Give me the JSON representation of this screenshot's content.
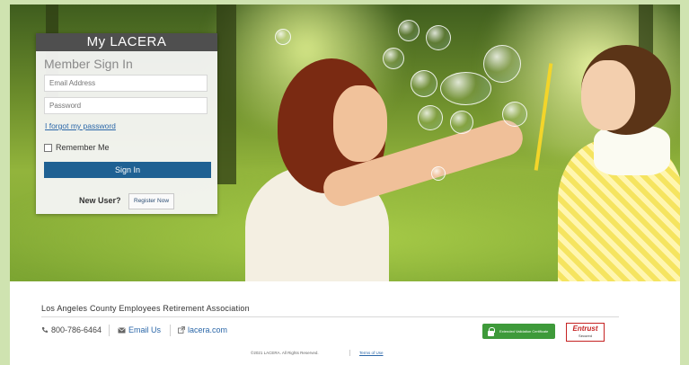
{
  "login": {
    "brand": "My LACERA",
    "title": "Member Sign In",
    "email_placeholder": "Email Address",
    "password_placeholder": "Password",
    "forgot_link": "I forgot my password",
    "remember_label": "Remember Me",
    "signin_label": "Sign In",
    "new_user_label": "New User?",
    "register_label": "Register Now"
  },
  "footer": {
    "org_name": "Los Angeles County Employees Retirement Association",
    "phone": "800-786-6464",
    "email_label": "Email Us",
    "website": "lacera.com",
    "ev_badge": "Extended Validation Certificate",
    "entrust_brand": "Entrust",
    "entrust_sub": "Secured",
    "copyright": "©2021 LACERA. All Rights Reserved.",
    "terms": "Terms of Use"
  },
  "colors": {
    "signin_button": "#1f6193",
    "header_bar": "#4f4f4f",
    "link": "#2b67a8",
    "ev_badge": "#3e9a3a",
    "entrust": "#c52222"
  },
  "icons": {
    "phone": "phone-icon",
    "email": "envelope-icon",
    "website": "external-link-icon",
    "lock": "lock-icon"
  }
}
